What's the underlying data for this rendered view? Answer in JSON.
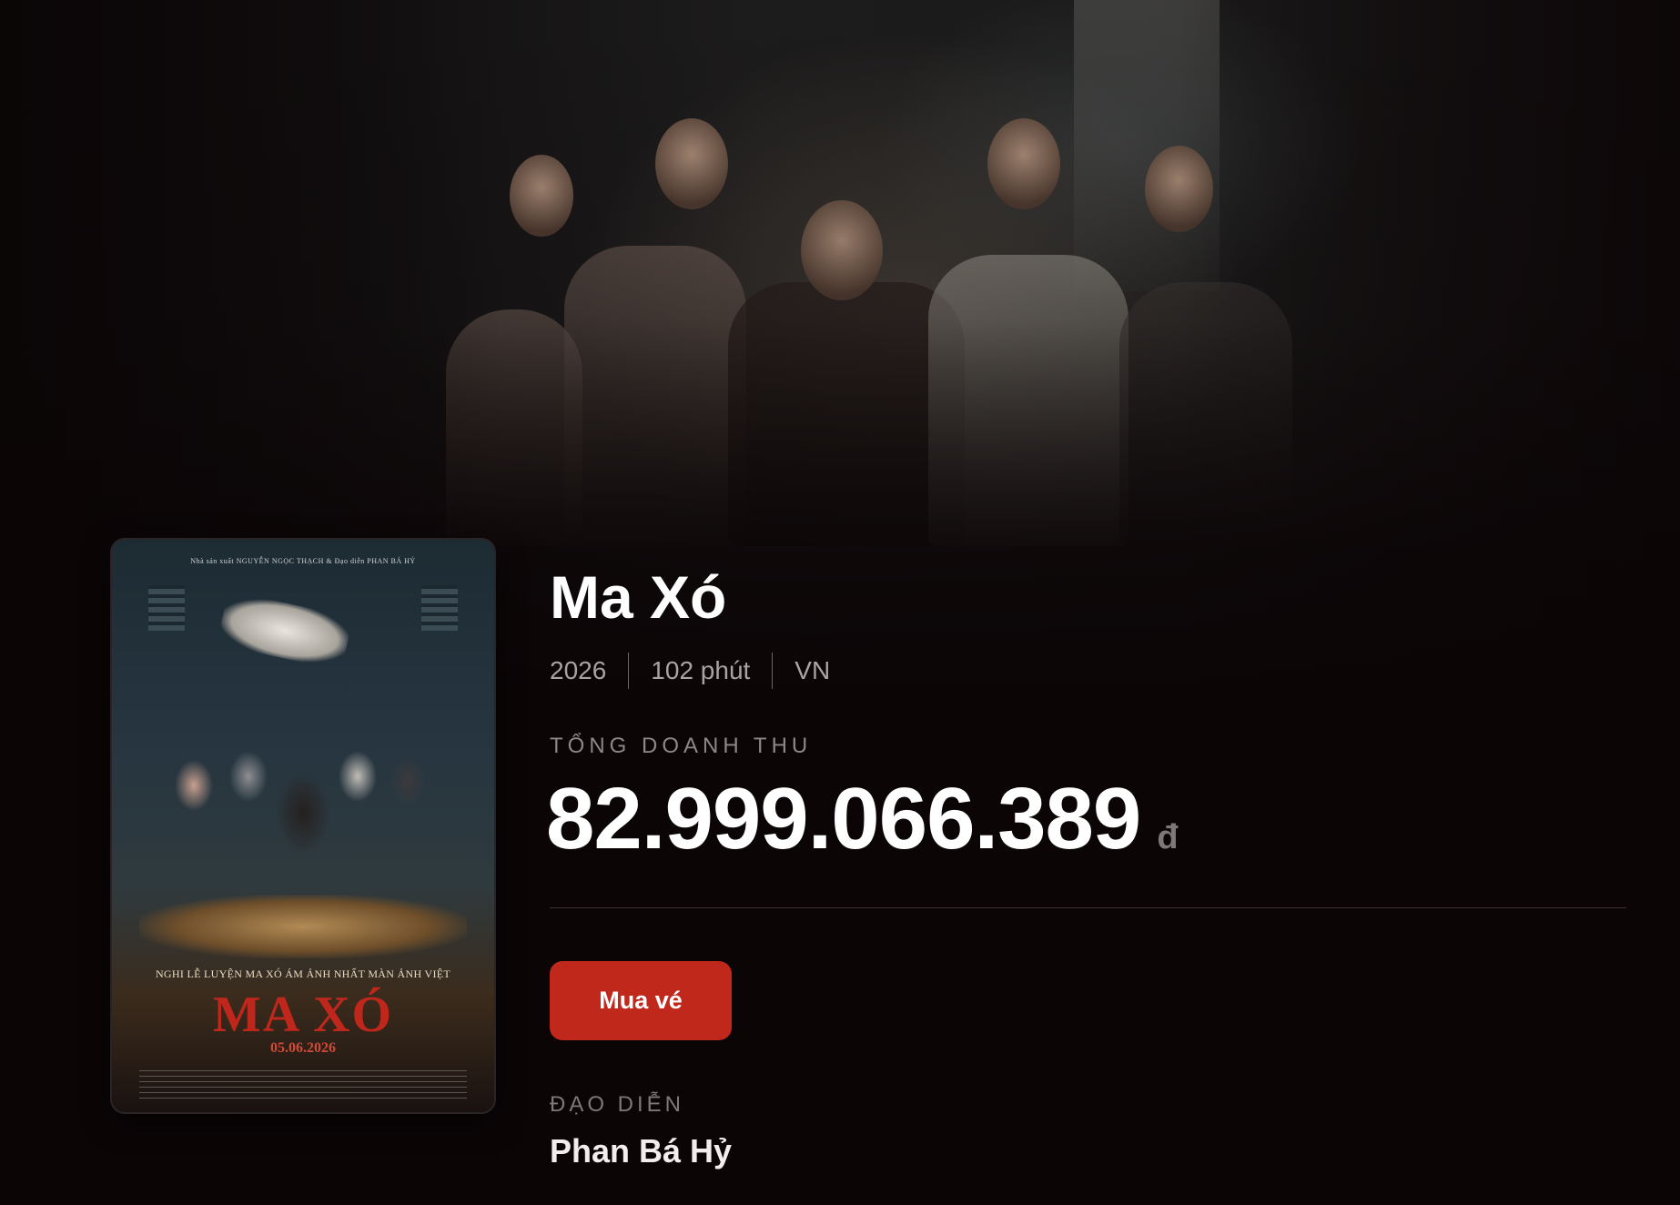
{
  "movie": {
    "title": "Ma Xó",
    "year": "2026",
    "duration": "102 phút",
    "country": "VN"
  },
  "revenue": {
    "label": "TỔNG DOANH THU",
    "amount": "82.999.066.389",
    "currency": "đ"
  },
  "actions": {
    "buy_label": "Mua vé"
  },
  "director": {
    "label": "ĐẠO DIỄN",
    "name": "Phan Bá Hỷ"
  },
  "poster": {
    "credits_top": "Nhà sản xuất NGUYỄN NGỌC THẠCH & Đạo diễn PHAN BÁ HỶ",
    "tagline": "NGHI LỄ LUYỆN MA XÓ ÁM ẢNH NHẤT MÀN ẢNH VIỆT",
    "title": "MA XÓ",
    "release": "05.06.2026"
  },
  "colors": {
    "accent": "#c0281c",
    "background": "#0b0506"
  }
}
